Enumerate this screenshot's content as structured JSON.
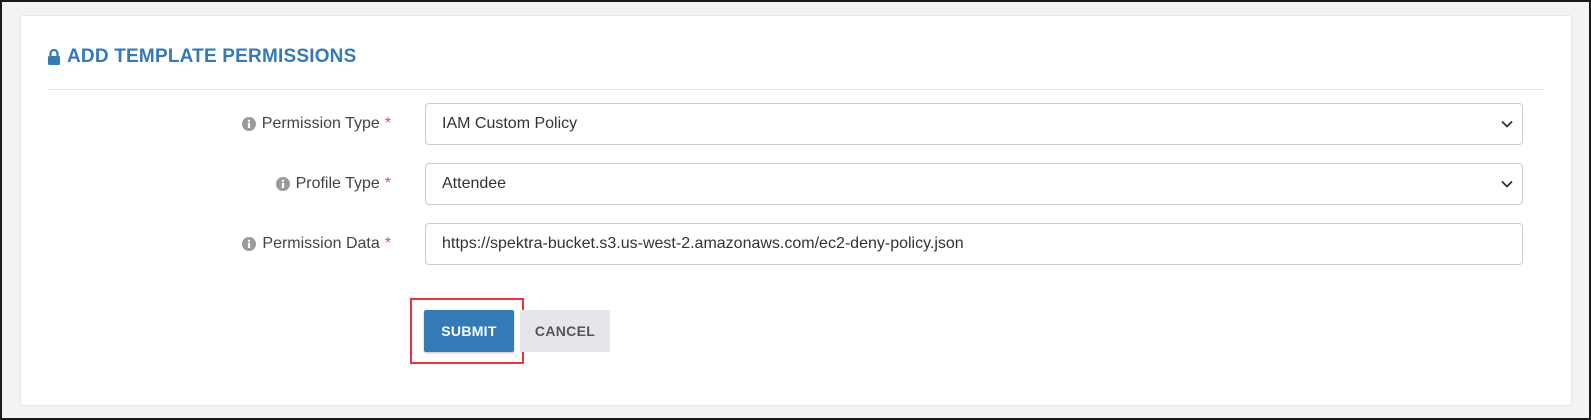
{
  "panel": {
    "title": "ADD TEMPLATE PERMISSIONS",
    "title_icon": "lock-icon",
    "accent_color": "#337ab7"
  },
  "form": {
    "permission_type": {
      "label": "Permission Type",
      "required_mark": "*",
      "value": "IAM Custom Policy"
    },
    "profile_type": {
      "label": "Profile Type",
      "required_mark": "*",
      "value": "Attendee"
    },
    "permission_data": {
      "label": "Permission Data",
      "required_mark": "*",
      "value": "https://spektra-bucket.s3.us-west-2.amazonaws.com/ec2-deny-policy.json"
    }
  },
  "actions": {
    "submit_label": "SUBMIT",
    "cancel_label": "CANCEL",
    "highlight_color": "#e0393e"
  }
}
